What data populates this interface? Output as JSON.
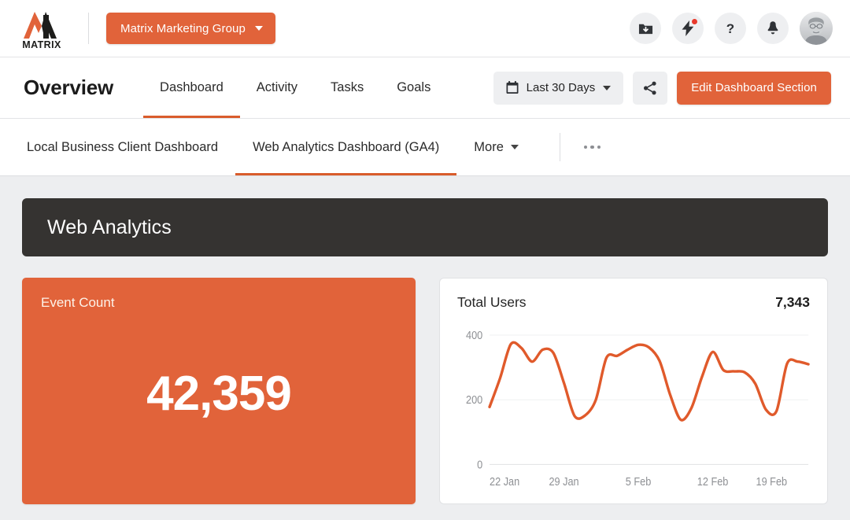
{
  "topbar": {
    "logo_text": "MATRIX",
    "org_button": "Matrix Marketing Group",
    "icons": {
      "download": "folder-download-icon",
      "flash": "lightning-bolt-icon",
      "help": "question-mark-icon",
      "notifications": "bell-icon",
      "avatar": "user-avatar"
    }
  },
  "nav": {
    "page_title": "Overview",
    "tabs": [
      {
        "label": "Dashboard",
        "active": true
      },
      {
        "label": "Activity",
        "active": false
      },
      {
        "label": "Tasks",
        "active": false
      },
      {
        "label": "Goals",
        "active": false
      }
    ],
    "date_range": "Last 30 Days",
    "share_label": "share-icon",
    "edit_button": "Edit Dashboard Section"
  },
  "subtabs": {
    "items": [
      {
        "label": "Local Business Client Dashboard",
        "active": false
      },
      {
        "label": "Web Analytics Dashboard (GA4)",
        "active": true
      },
      {
        "label": "More",
        "active": false
      }
    ],
    "overflow": "more-options-icon"
  },
  "section": {
    "title": "Web Analytics"
  },
  "kpi": {
    "label": "Event Count",
    "value": "42,359"
  },
  "colors": {
    "accent_orange": "#e1633a",
    "tab_underline": "#d95c2c",
    "section_dark": "#353331",
    "page_background": "#edeef0",
    "chart_line": "#e05a2b",
    "badge_red": "#e8392c"
  },
  "chart_data": {
    "type": "line",
    "title": "Total Users",
    "total_label": "7,343",
    "xlabel": "",
    "ylabel": "",
    "ylim": [
      0,
      430
    ],
    "yticks": [
      0,
      200,
      400
    ],
    "ytick_labels": [
      "0",
      "200",
      "400"
    ],
    "xticks": [
      "22 Jan",
      "29 Jan",
      "5 Feb",
      "12 Feb",
      "19 Feb"
    ],
    "xtick_positions": [
      0,
      7,
      14,
      21,
      28
    ],
    "grid": true,
    "legend": "none",
    "line_color": "#e05a2b",
    "x": [
      0,
      1,
      2,
      3,
      4,
      5,
      6,
      7,
      8,
      9,
      10,
      11,
      12,
      13,
      14,
      15,
      16,
      17,
      18,
      19,
      20,
      21,
      22,
      23,
      24,
      25,
      26,
      27,
      28,
      29,
      30
    ],
    "series": [
      {
        "name": "Total Users",
        "values": [
          178,
          268,
          372,
          360,
          318,
          355,
          345,
          252,
          150,
          152,
          200,
          330,
          336,
          355,
          370,
          362,
          320,
          215,
          138,
          175,
          272,
          348,
          292,
          288,
          285,
          250,
          170,
          165,
          312,
          318,
          310
        ]
      }
    ]
  }
}
